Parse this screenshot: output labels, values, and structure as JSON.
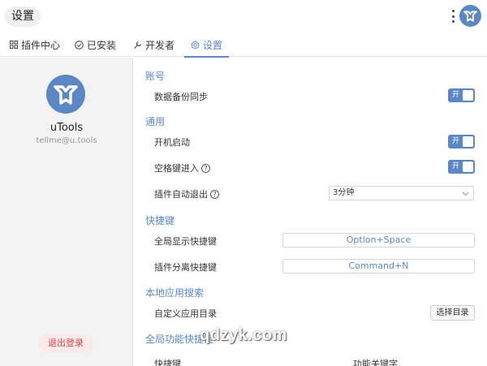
{
  "window": {
    "title": "设置"
  },
  "tabs": [
    {
      "label": "插件中心",
      "icon": "grid-icon"
    },
    {
      "label": "已安装",
      "icon": "check-circle-icon"
    },
    {
      "label": "开发者",
      "icon": "wrench-icon"
    },
    {
      "label": "设置",
      "icon": "gear-icon",
      "active": true
    }
  ],
  "sidebar": {
    "app_name": "uTools",
    "email": "tellme@u.tools",
    "logout_label": "退出登录"
  },
  "account": {
    "heading": "账号",
    "sync_label": "数据备份同步",
    "sync_toggle": "开"
  },
  "general": {
    "heading": "通用",
    "autostart_label": "开机启动",
    "autostart_toggle": "开",
    "space_enter_label": "空格键进入",
    "space_enter_toggle": "开",
    "plugin_exit_label": "插件自动退出",
    "plugin_exit_value": "3分钟"
  },
  "shortcuts": {
    "heading": "快捷键",
    "global_show_label": "全局显示快捷键",
    "global_show_value": "Option+Space",
    "detach_label": "插件分离快捷键",
    "detach_value": "Command+N"
  },
  "local_search": {
    "heading": "本地应用搜索",
    "custom_dir_label": "自定义应用目录",
    "choose_dir_button": "选择目录"
  },
  "global_func": {
    "heading": "全局功能快捷键",
    "col_hotkey": "快捷键",
    "col_keyword": "功能关键字"
  },
  "watermark": "qdzyk.com",
  "colors": {
    "accent": "#5b87c6",
    "danger": "#d9464a",
    "sidebar_bg": "#f3f3f3"
  }
}
